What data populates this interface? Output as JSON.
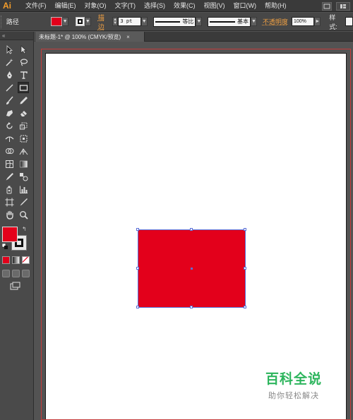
{
  "app": {
    "logo": "Ai"
  },
  "menu": {
    "items": [
      {
        "label": "文件(F)"
      },
      {
        "label": "编辑(E)"
      },
      {
        "label": "对象(O)"
      },
      {
        "label": "文字(T)"
      },
      {
        "label": "选择(S)"
      },
      {
        "label": "效果(C)"
      },
      {
        "label": "视图(V)"
      },
      {
        "label": "窗口(W)"
      },
      {
        "label": "帮助(H)"
      }
    ]
  },
  "control_bar": {
    "selection_type": "路径",
    "fill_color": "#e3001b",
    "stroke_label": "描边",
    "stroke_weight": "3 pt",
    "variable_width_profile": "等比",
    "brush_definition": "基本",
    "opacity_label": "不透明度",
    "opacity_value": "100%",
    "style_label": "样式:"
  },
  "document": {
    "tab_title": "未标题-1* @ 100% (CMYK/预览)",
    "tab_close": "×"
  },
  "artwork": {
    "rectangle_fill": "#e3001b",
    "selection_color": "#5b6ed6"
  },
  "watermark": {
    "title": "百科全说",
    "subtitle": "助你轻松解决"
  },
  "tools_panel": {
    "collapse_glyph": "«",
    "fill_color": "#e3001b"
  }
}
